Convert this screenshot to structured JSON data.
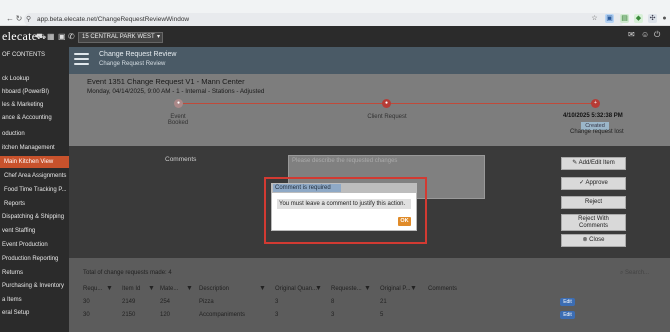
{
  "browser": {
    "url": "app.beta.elecate.net/ChangeRequestReviewWindow"
  },
  "app": {
    "logo": "elecate",
    "venue_select": "15 CENTRAL PARK WEST"
  },
  "sidebar": {
    "items": [
      {
        "label": "OF CONTENTS"
      },
      {
        "label": "ck Lookup"
      },
      {
        "label": "hboard (PowerBI)"
      },
      {
        "label": "les & Marketing"
      },
      {
        "label": "ance & Accounting"
      },
      {
        "label": "oduction"
      },
      {
        "label": "itchen Management"
      },
      {
        "label": "Main Kitchen View"
      },
      {
        "label": "Chef Area Assignments"
      },
      {
        "label": "Food Time Tracking P..."
      },
      {
        "label": "Reports"
      },
      {
        "label": "Dispatching & Shipping"
      },
      {
        "label": "vent Staffing"
      },
      {
        "label": "Event Production"
      },
      {
        "label": "Production Reporting"
      },
      {
        "label": "Returns"
      },
      {
        "label": "Purchasing & Inventory"
      },
      {
        "label": "a Items"
      },
      {
        "label": "eral Setup"
      }
    ]
  },
  "page": {
    "title": "Change Request Review",
    "subtitle": "Change Request Review"
  },
  "event": {
    "title": "Event 1351 Change Request V1 - Mann Center",
    "details": "Monday, 04/14/2025, 9:00 AM - 1 - Internal - Stations - Adjusted"
  },
  "progress": {
    "steps": [
      {
        "label": "Event Booked"
      },
      {
        "label": "Client Request"
      },
      {
        "label": "Change request lost"
      }
    ],
    "status_date": "4/10/2025 5:32:38 PM",
    "status_tag": "Created"
  },
  "form": {
    "comments_label": "Comments",
    "comments_placeholder": "Please describe the requested changes"
  },
  "actions": {
    "add_edit": "Add/Edit Item",
    "approve": "Approve",
    "reject": "Reject",
    "reject_with_comments_1": "Reject With",
    "reject_with_comments_2": "Comments",
    "close": "Close"
  },
  "modal": {
    "title": "Comment is required",
    "message": "You must leave a comment to justify this action.",
    "ok": "OK"
  },
  "table": {
    "total": "Total of change requests made: 4",
    "search_placeholder": "Search...",
    "headers": [
      "Requ...",
      "Item Id",
      "Mate...",
      "Description",
      "Original Quan...",
      "Requeste...",
      "Original P...",
      "Comments"
    ],
    "rows": [
      {
        "req": "30",
        "item": "2149",
        "mate": "254",
        "desc": "Pizza",
        "oq": "3",
        "rq": "8",
        "op": "21",
        "comments": "",
        "edit": "Edit"
      },
      {
        "req": "30",
        "item": "2150",
        "mate": "120",
        "desc": "Accompaniments",
        "oq": "3",
        "rq": "3",
        "op": "5",
        "comments": "",
        "edit": "Edit"
      }
    ]
  }
}
